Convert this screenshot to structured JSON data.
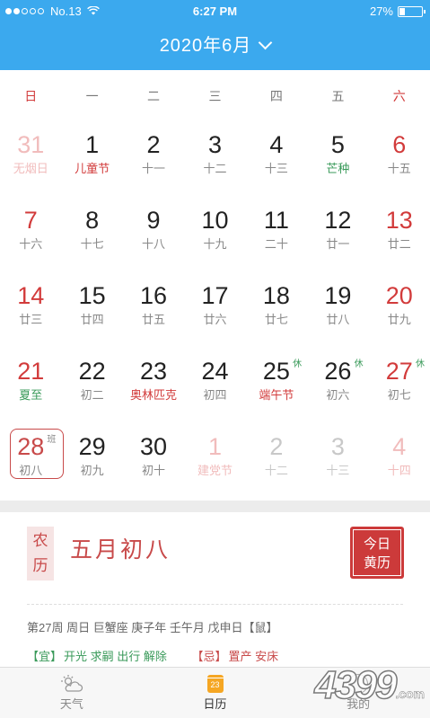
{
  "status_bar": {
    "signal_full": 2,
    "signal_total": 5,
    "carrier": "No.13",
    "time": "6:27 PM",
    "battery_percent": "27%",
    "battery_level": 0.27
  },
  "header": {
    "month_title": "2020年6月"
  },
  "weekdays": [
    "日",
    "一",
    "二",
    "三",
    "四",
    "五",
    "六"
  ],
  "days": [
    {
      "num": "31",
      "sub": "无烟日",
      "state": "prev",
      "sub_style": "pink"
    },
    {
      "num": "1",
      "sub": "儿童节",
      "sub_style": "red"
    },
    {
      "num": "2",
      "sub": "十一"
    },
    {
      "num": "3",
      "sub": "十二"
    },
    {
      "num": "4",
      "sub": "十三"
    },
    {
      "num": "5",
      "sub": "芒种",
      "sub_style": "green"
    },
    {
      "num": "6",
      "sub": "十五"
    },
    {
      "num": "7",
      "sub": "十六"
    },
    {
      "num": "8",
      "sub": "十七"
    },
    {
      "num": "9",
      "sub": "十八"
    },
    {
      "num": "10",
      "sub": "十九"
    },
    {
      "num": "11",
      "sub": "二十"
    },
    {
      "num": "12",
      "sub": "廿一"
    },
    {
      "num": "13",
      "sub": "廿二"
    },
    {
      "num": "14",
      "sub": "廿三"
    },
    {
      "num": "15",
      "sub": "廿四"
    },
    {
      "num": "16",
      "sub": "廿五"
    },
    {
      "num": "17",
      "sub": "廿六"
    },
    {
      "num": "18",
      "sub": "廿七"
    },
    {
      "num": "19",
      "sub": "廿八"
    },
    {
      "num": "20",
      "sub": "廿九"
    },
    {
      "num": "21",
      "sub": "夏至",
      "sub_style": "green"
    },
    {
      "num": "22",
      "sub": "初二"
    },
    {
      "num": "23",
      "sub": "奥林匹克",
      "sub_style": "red"
    },
    {
      "num": "24",
      "sub": "初四"
    },
    {
      "num": "25",
      "sub": "端午节",
      "sub_style": "red",
      "badge": "休"
    },
    {
      "num": "26",
      "sub": "初六",
      "badge": "休"
    },
    {
      "num": "27",
      "sub": "初七",
      "badge": "休"
    },
    {
      "num": "28",
      "sub": "初八",
      "badge": "班",
      "state": "today"
    },
    {
      "num": "29",
      "sub": "初九"
    },
    {
      "num": "30",
      "sub": "初十"
    },
    {
      "num": "1",
      "sub": "建党节",
      "state": "next",
      "sub_style": "pink"
    },
    {
      "num": "2",
      "sub": "十二",
      "state": "next"
    },
    {
      "num": "3",
      "sub": "十三",
      "state": "next"
    },
    {
      "num": "4",
      "sub": "十四",
      "state": "next"
    }
  ],
  "detail": {
    "lunar_label_1": "农",
    "lunar_label_2": "历",
    "lunar_date": "五月初八",
    "almanac_button_1": "今日",
    "almanac_button_2": "黄历",
    "info_line": "第27周 周日 巨蟹座 庚子年 壬午月 戊申日【鼠】",
    "yi_label": "【宜】",
    "yi_items": "开光 求嗣 出行 解除",
    "ji_label": "【忌】",
    "ji_items": "置产 安床"
  },
  "tabs": [
    {
      "label": "天气",
      "icon": "weather-icon"
    },
    {
      "label": "日历",
      "icon": "calendar-icon",
      "icon_text": "23",
      "active": true
    },
    {
      "label": "我的",
      "icon": "profile-icon"
    }
  ],
  "watermark": {
    "text": "4399",
    "suffix": ".com"
  },
  "colors": {
    "header_blue": "#3ba9ee",
    "holiday_red": "#d23b3b",
    "term_green": "#3a9a5a",
    "almanac_red": "#cc3a3a"
  }
}
